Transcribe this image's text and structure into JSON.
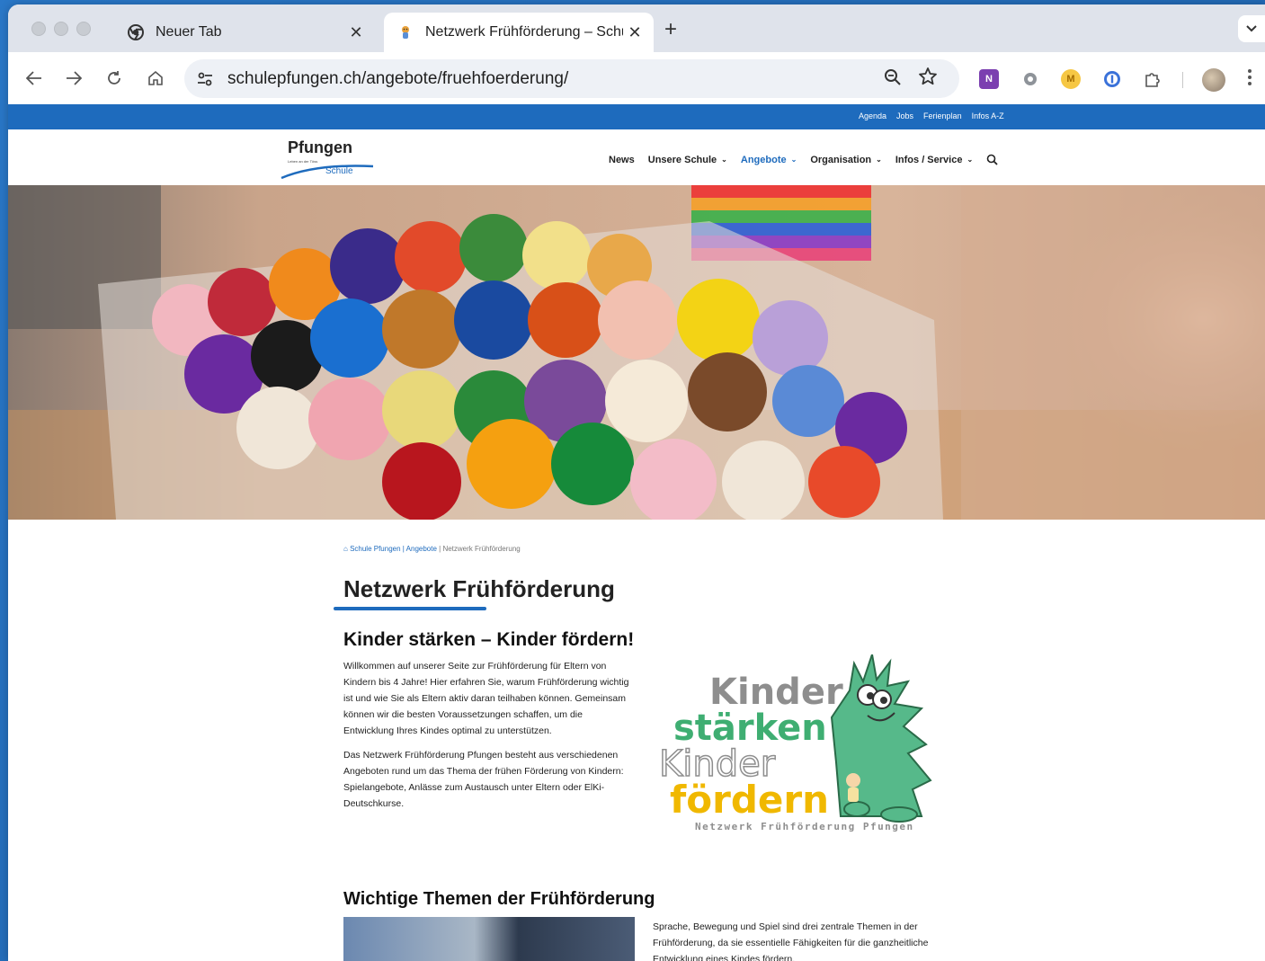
{
  "browser": {
    "tabs": [
      {
        "title": "Neuer Tab",
        "close": "✕"
      },
      {
        "title": "Netzwerk Frühförderung – Schule Pfungen",
        "close": "✕"
      }
    ],
    "new_tab": "+",
    "url": "schulepfungen.ch/angebote/fruehfoerderung/",
    "extensions": [
      "onenote-icon",
      "settings-extension-icon",
      "M",
      "1password-icon",
      "puzzle-icon"
    ],
    "ext_m": "M"
  },
  "site": {
    "top_links": [
      "Agenda",
      "Jobs",
      "Ferienplan",
      "Infos A-Z"
    ],
    "logo": {
      "name": "Pfungen",
      "tagline": "Leben an der Töss",
      "sub": "Schule"
    },
    "nav": [
      {
        "label": "News",
        "dropdown": false
      },
      {
        "label": "Unsere Schule",
        "dropdown": true
      },
      {
        "label": "Angebote",
        "dropdown": true,
        "active": true
      },
      {
        "label": "Organisation",
        "dropdown": true
      },
      {
        "label": "Infos / Service",
        "dropdown": true
      }
    ],
    "accent": "#1e6bbd"
  },
  "breadcrumb": {
    "home": "Schule Pfungen",
    "sep": " | ",
    "parent": "Angebote",
    "current": "Netzwerk Frühförderung"
  },
  "main": {
    "title": "Netzwerk Frühförderung",
    "subtitle": "Kinder stärken – Kinder fördern!",
    "para1": "Willkommen auf unserer Seite zur Frühförderung für Eltern von Kindern bis 4 Jahre! Hier erfahren Sie, warum Frühförderung wichtig ist und wie Sie als Eltern aktiv daran teilhaben können. Gemeinsam können wir die besten Voraussetzungen schaffen, um die Entwicklung Ihres Kindes optimal zu unterstützen.",
    "para2": "Das Netzwerk Frühförderung Pfungen besteht aus verschiedenen Angeboten rund um das Thema der frühen Förderung von Kindern: Spielangebote, Anlässe zum Austausch unter Eltern oder ElKi-Deutschkurse.",
    "logo_text": {
      "l1": "Kinder",
      "l2": "stärken",
      "l3": "Kinder",
      "l4": "fördern",
      "l5": "Netzwerk Frühförderung Pfungen"
    },
    "section2_title": "Wichtige Themen der Frühförderung",
    "section2_text": "Sprache, Bewegung und Spiel sind drei zentrale Themen in der Frühförderung, da sie essentielle Fähigkeiten für die ganzheitliche Entwicklung eines Kindes fördern."
  }
}
